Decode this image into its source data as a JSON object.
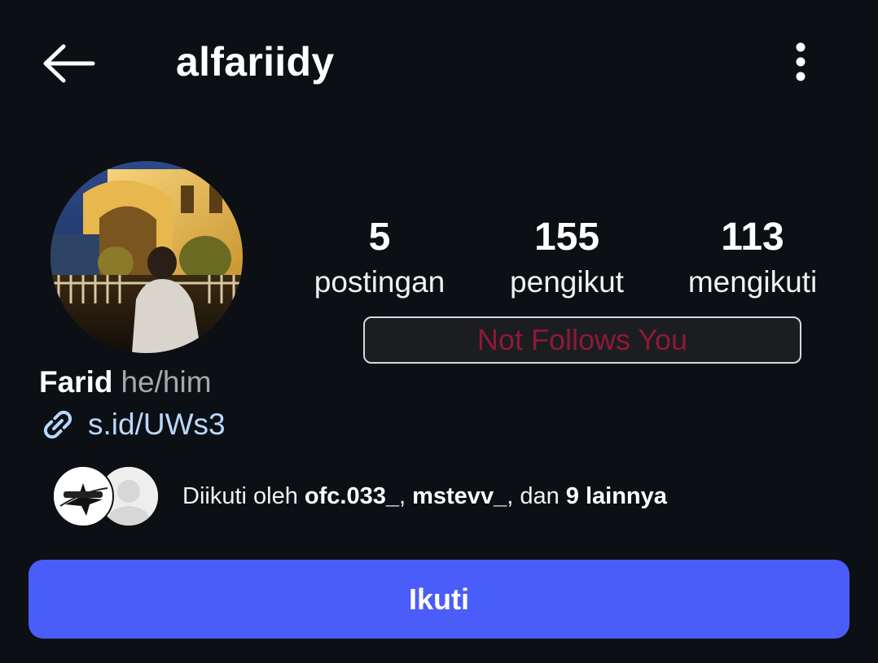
{
  "header": {
    "username": "alfariidy",
    "back_icon": "arrow-left-icon",
    "more_icon": "more-vertical-icon"
  },
  "stats": [
    {
      "value": "5",
      "label": "postingan"
    },
    {
      "value": "155",
      "label": "pengikut"
    },
    {
      "value": "113",
      "label": "mengikuti"
    }
  ],
  "badge": {
    "text": "Not Follows You",
    "color": "#8c1a36"
  },
  "bio": {
    "name": "Farid",
    "pronouns": "he/him",
    "link_icon": "link-icon",
    "link": "s.id/UWs3"
  },
  "mutual": {
    "prefix": "Diikuti oleh ",
    "user1": "ofc.033_",
    "sep": ", ",
    "user2": "mstevv_",
    "middle": ", dan ",
    "others": "9 lainnya"
  },
  "follow_button": {
    "label": "Ikuti",
    "color": "#4a5df9"
  }
}
